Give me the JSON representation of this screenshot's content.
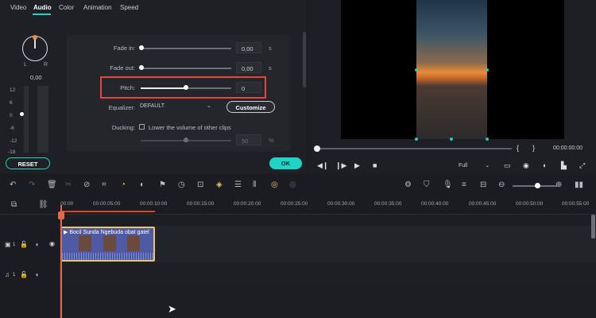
{
  "tabs": [
    {
      "label": "Video"
    },
    {
      "label": "Audio"
    },
    {
      "label": "Color"
    },
    {
      "label": "Animation"
    },
    {
      "label": "Speed"
    }
  ],
  "balance": {
    "left": "L",
    "right": "R",
    "value": "0,00"
  },
  "meter_scale": [
    "12",
    "6",
    "0",
    "-6",
    "-12",
    "-18"
  ],
  "fade_in": {
    "label": "Fade in:",
    "value": "0,00",
    "unit": "s"
  },
  "fade_out": {
    "label": "Fade out:",
    "value": "0,00",
    "unit": "s"
  },
  "pitch": {
    "label": "Pitch:",
    "value": "0"
  },
  "equalizer": {
    "label": "Equalizer:",
    "value": "DEFAULT",
    "customize": "Customize"
  },
  "ducking": {
    "label": "Ducking:",
    "checkbox_label": "Lower the volume of other clips",
    "value": "50",
    "unit": "%"
  },
  "buttons": {
    "reset": "RESET",
    "ok": "OK"
  },
  "preview": {
    "bracket_open": "{",
    "bracket_close": "}",
    "timecode": "00:00:00:00",
    "zoom": "Full"
  },
  "ruler": [
    "00:00",
    "00:00:05:00",
    "00:00:10:00",
    "00:00:15:00",
    "00:00:20:00",
    "00:00:25:00",
    "00:00:30:00",
    "00:00:35:00",
    "00:00:40:00",
    "00:00:45:00",
    "00:00:50:00",
    "00:00:55:00"
  ],
  "tracks": {
    "video_index": "1",
    "audio_index": "1"
  },
  "clip": {
    "title": "Bocil Sunda Ngebuda obat gatel"
  },
  "colors": {
    "accent": "#1fd3c7",
    "highlight": "#e5453e",
    "clip": "#4e5aa3",
    "clip_border": "#e8c46a",
    "playhead": "#e8694a"
  }
}
